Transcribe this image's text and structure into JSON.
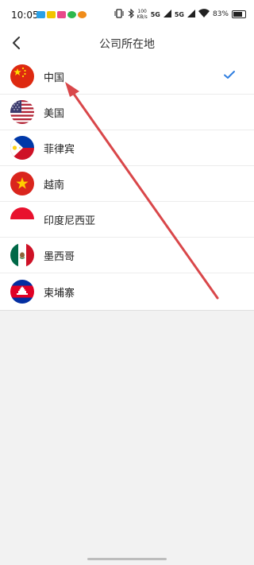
{
  "status_bar": {
    "time": "10:05",
    "net_speed_value": "100",
    "net_speed_unit": "KB/s",
    "network_1": "5G",
    "network_2": "5G",
    "battery": "83%",
    "battery_level": 0.83
  },
  "header": {
    "title": "公司所在地",
    "back_icon": "chevron-left-icon"
  },
  "countries": [
    {
      "label": "中国",
      "flag": "china-flag-icon",
      "selected": true
    },
    {
      "label": "美国",
      "flag": "usa-flag-icon",
      "selected": false
    },
    {
      "label": "菲律宾",
      "flag": "philippines-flag-icon",
      "selected": false
    },
    {
      "label": "越南",
      "flag": "vietnam-flag-icon",
      "selected": false
    },
    {
      "label": "印度尼西亚",
      "flag": "indonesia-flag-icon",
      "selected": false
    },
    {
      "label": "墨西哥",
      "flag": "mexico-flag-icon",
      "selected": false
    },
    {
      "label": "柬埔寨",
      "flag": "cambodia-flag-icon",
      "selected": false
    }
  ],
  "colors": {
    "accent_check": "#2f7ee0",
    "annotation_arrow": "#d9474a"
  }
}
